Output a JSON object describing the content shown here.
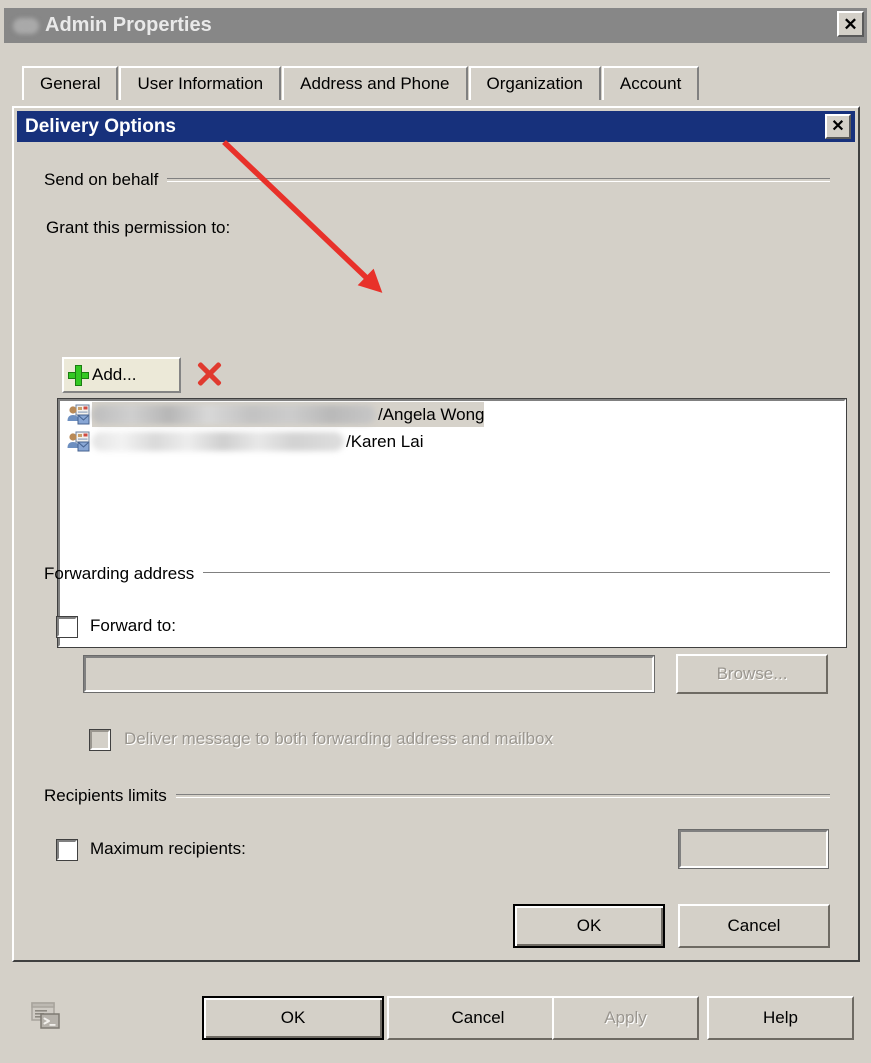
{
  "window": {
    "title": "Admin Properties",
    "title_icon": "blurred-redaction-icon",
    "close_label": "✕",
    "tabs": [
      {
        "label": "General"
      },
      {
        "label": "User Information"
      },
      {
        "label": "Address and Phone"
      },
      {
        "label": "Organization"
      },
      {
        "label": "Account"
      }
    ],
    "footer_buttons": [
      {
        "label": "OK",
        "state": "default"
      },
      {
        "label": "Cancel",
        "state": "normal"
      },
      {
        "label": "Apply",
        "state": "disabled"
      },
      {
        "label": "Help",
        "state": "normal"
      }
    ],
    "footer_icon": "powershell-script-icon"
  },
  "dialog": {
    "title": "Delivery Options",
    "close_label": "✕",
    "send_on_behalf": {
      "caption": "Send on behalf",
      "grant_label": "Grant this permission to:",
      "add_button": "Add...",
      "add_icon": "green-plus-icon",
      "delete_icon": "red-x-delete-icon",
      "entries": [
        {
          "icon": "user-mailbox-icon",
          "redacted_prefix": "",
          "name": "/Angela Wong",
          "selected": true
        },
        {
          "icon": "user-mailbox-icon",
          "redacted_prefix": "",
          "name": "/Karen Lai",
          "selected": false
        }
      ]
    },
    "forwarding_address": {
      "caption": "Forwarding address",
      "forward_to_label": "Forward to:",
      "forward_to_checked": false,
      "forward_to_value": "",
      "forward_to_placeholder": "",
      "browse_button": "Browse...",
      "browse_enabled": false,
      "deliver_both_label": "Deliver message to both forwarding address and mailbox",
      "deliver_both_checked": false,
      "deliver_both_enabled": false
    },
    "recipients_limits": {
      "caption": "Recipients limits",
      "maximum_recipients_label": "Maximum recipients:",
      "maximum_recipients_checked": false,
      "maximum_recipients_value": ""
    },
    "buttons": [
      {
        "label": "OK",
        "state": "default"
      },
      {
        "label": "Cancel",
        "state": "normal"
      }
    ]
  },
  "annotation": {
    "type": "red-arrow",
    "color": "#e8312a",
    "points_to": "permission-list"
  },
  "colors": {
    "window_face": "#d4d0c8",
    "inactive_titlebar": "#878787",
    "active_titlebar": "#17317c",
    "selection": "#d6d2ca",
    "annotation_red": "#e8312a",
    "add_green": "#34c924",
    "delete_red": "#e03a2f"
  }
}
